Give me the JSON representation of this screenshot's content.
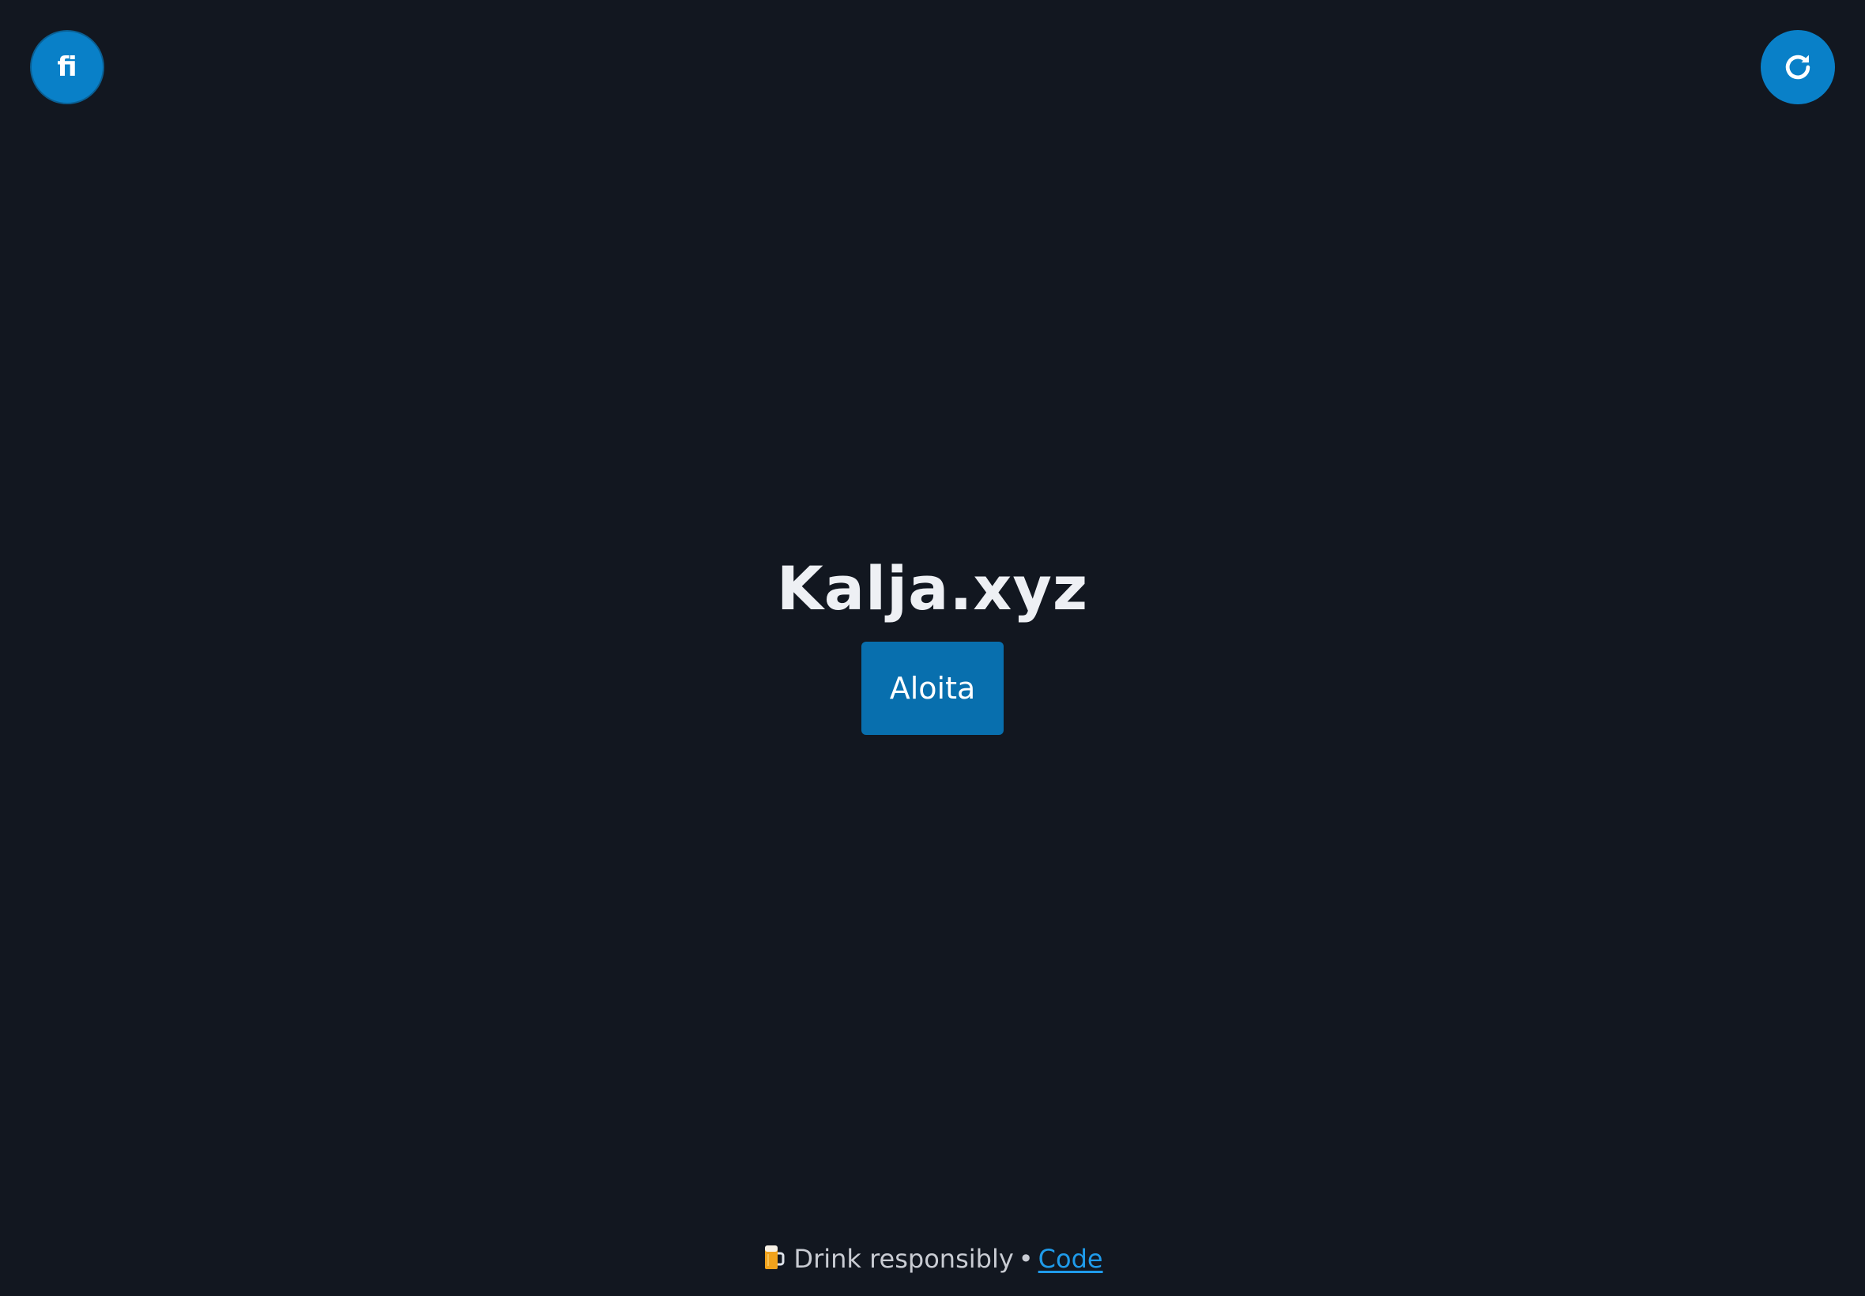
{
  "header": {
    "language_button_label": "fi",
    "reset_icon": "refresh-icon"
  },
  "main": {
    "title": "Kalja.xyz",
    "start_button_label": "Aloita"
  },
  "footer": {
    "icon": "beer-mug-icon",
    "text": "Drink responsibly",
    "separator": "•",
    "code_link_label": "Code"
  },
  "colors": {
    "background": "#121720",
    "accent": "#0980c8",
    "link": "#1f9bea"
  }
}
